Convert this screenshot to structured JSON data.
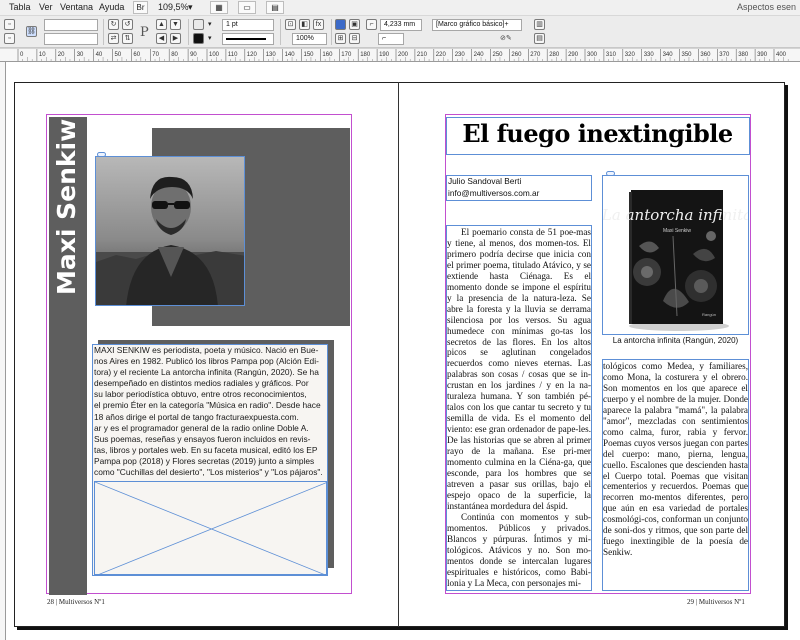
{
  "menubar": {
    "items": [
      "Tabla",
      "Ver",
      "Ventana",
      "Ayuda"
    ],
    "zoom": "109,5%",
    "workspace": "Aspectos esen"
  },
  "controlpanel": {
    "stroke_weight": "1 pt",
    "scale_percent": "100%",
    "width_value": "4,233 mm",
    "object_style": "[Marco gráfico básico]+",
    "letter_p": "P"
  },
  "ruler": {
    "labels": [
      "0",
      "10",
      "20",
      "30",
      "40",
      "50",
      "60",
      "70",
      "80",
      "90",
      "100",
      "110",
      "120",
      "130",
      "140",
      "150",
      "160",
      "170",
      "180",
      "190",
      "200",
      "210",
      "220",
      "230",
      "240",
      "250",
      "260",
      "270",
      "280",
      "290",
      "300",
      "310",
      "320",
      "330",
      "340",
      "350",
      "360",
      "370",
      "380",
      "390",
      "400"
    ]
  },
  "left_page": {
    "author_vertical": "Maxi Senkiw",
    "bio": "MAXI SENKIW es periodista, poeta y músico. Nació en Bue-\nnos Aires en 1982. Publicó los libros Pampa pop (Alción Edi-\ntora) y el reciente La antorcha infinita (Rangún, 2020). Se ha\ndesempeñado en distintos medios radiales y gráficos. Por\nsu labor periodística obtuvo, entre otros reconocimientos,\nel premio Éter en la categoría \"Música en radio\". Desde hace\n18 años dirige el portal de tango fracturaexpuesta.com.\nar y es el programador general de la radio online Doble A.\nSus poemas, reseñas y ensayos fueron incluidos en revis-\ntas, libros y portales web. En su faceta musical, editó los EP\nPampa pop (2018) y Flores secretas (2019) junto a simples\ncomo \"Cuchillas del desierto\", \"Los misterios\" y \"Los pájaros\".",
    "folio": "28 | Multiversos Nº1"
  },
  "right_page": {
    "title": "El fuego inextingible",
    "byline": [
      "Julio Sandoval Berti",
      "info@multiversos.com.ar"
    ],
    "col1": [
      "El poemario consta de 51 poe-mas y tiene, al menos, dos momen-tos. El primero podría decirse que inicia con el primer poema, titulado Atávico, y se extiende hasta Ciénaga. Es el momento donde se impone el espíritu y la presencia de la natura-leza. Se abre la foresta y la lluvia se derrama silenciosa por los versos. Su agua humedece con mínimas go-tas los secretos de las flores. En los altos picos se aglutinan congelados recuerdos como nieves eternas. Las palabras son cosas / cosas que se in-crustan en los jardines / y en la na-turaleza humana. Y son también pé-talos con los que cantar tu secreto y tu semilla de vida. Es el momento del viento: ese gran ordenador de pape-les. De las historias que se abren al primer rayo de la mañana. Ese pri-mer momento culmina en la Ciéna-ga, que esconde, para los hombres que se atreven a pasar sus orillas, bajo el espejo opaco de la superficie, la instantánea mordedura del áspid.",
      "Continúa con momentos y sub-momentos. Públicos y privados. Blancos y púrpuras. Íntimos y mi-tológicos. Atávicos y no. Son mo-mentos donde se intercalan lugares espirituales e históricos, como Babi-lonia y La Meca, con personajes mi-"
    ],
    "col2": "tológicos como Medea, y familiares, como Mona, la costurera y el obrero. Son momentos en los que aparece el cuerpo y el nombre de la mujer. Donde aparece la palabra \"mamá\", la palabra \"amor\", mezcladas con sentimientos como calma, furor, rabia y fervor. Poemas cuyos versos juegan con partes del cuerpo: mano, pierna, lengua, cuello. Escalones que descienden hasta el Cuerpo total. Poemas que visitan cementerios y recuerdos. Poemas que recorren mo-mentos diferentes, pero que aún en esa variedad de portales cosmológi-cos, conforman un conjunto de soni-dos y ritmos, que son parte del fuego inextingible de la poesía de Senkiw.",
    "book": {
      "cover_title": "La antorcha infinita",
      "cover_author": "Maxi Senkiw",
      "publisher": "Rangún",
      "caption": "La antorcha infinita (Rangún, 2020)"
    },
    "folio": "29 | Multiversos Nº1"
  },
  "colors": {
    "accent_gray": "#5e5e5e",
    "margin_guide": "#c24fcf",
    "frame_blue": "#5d8fd6"
  }
}
